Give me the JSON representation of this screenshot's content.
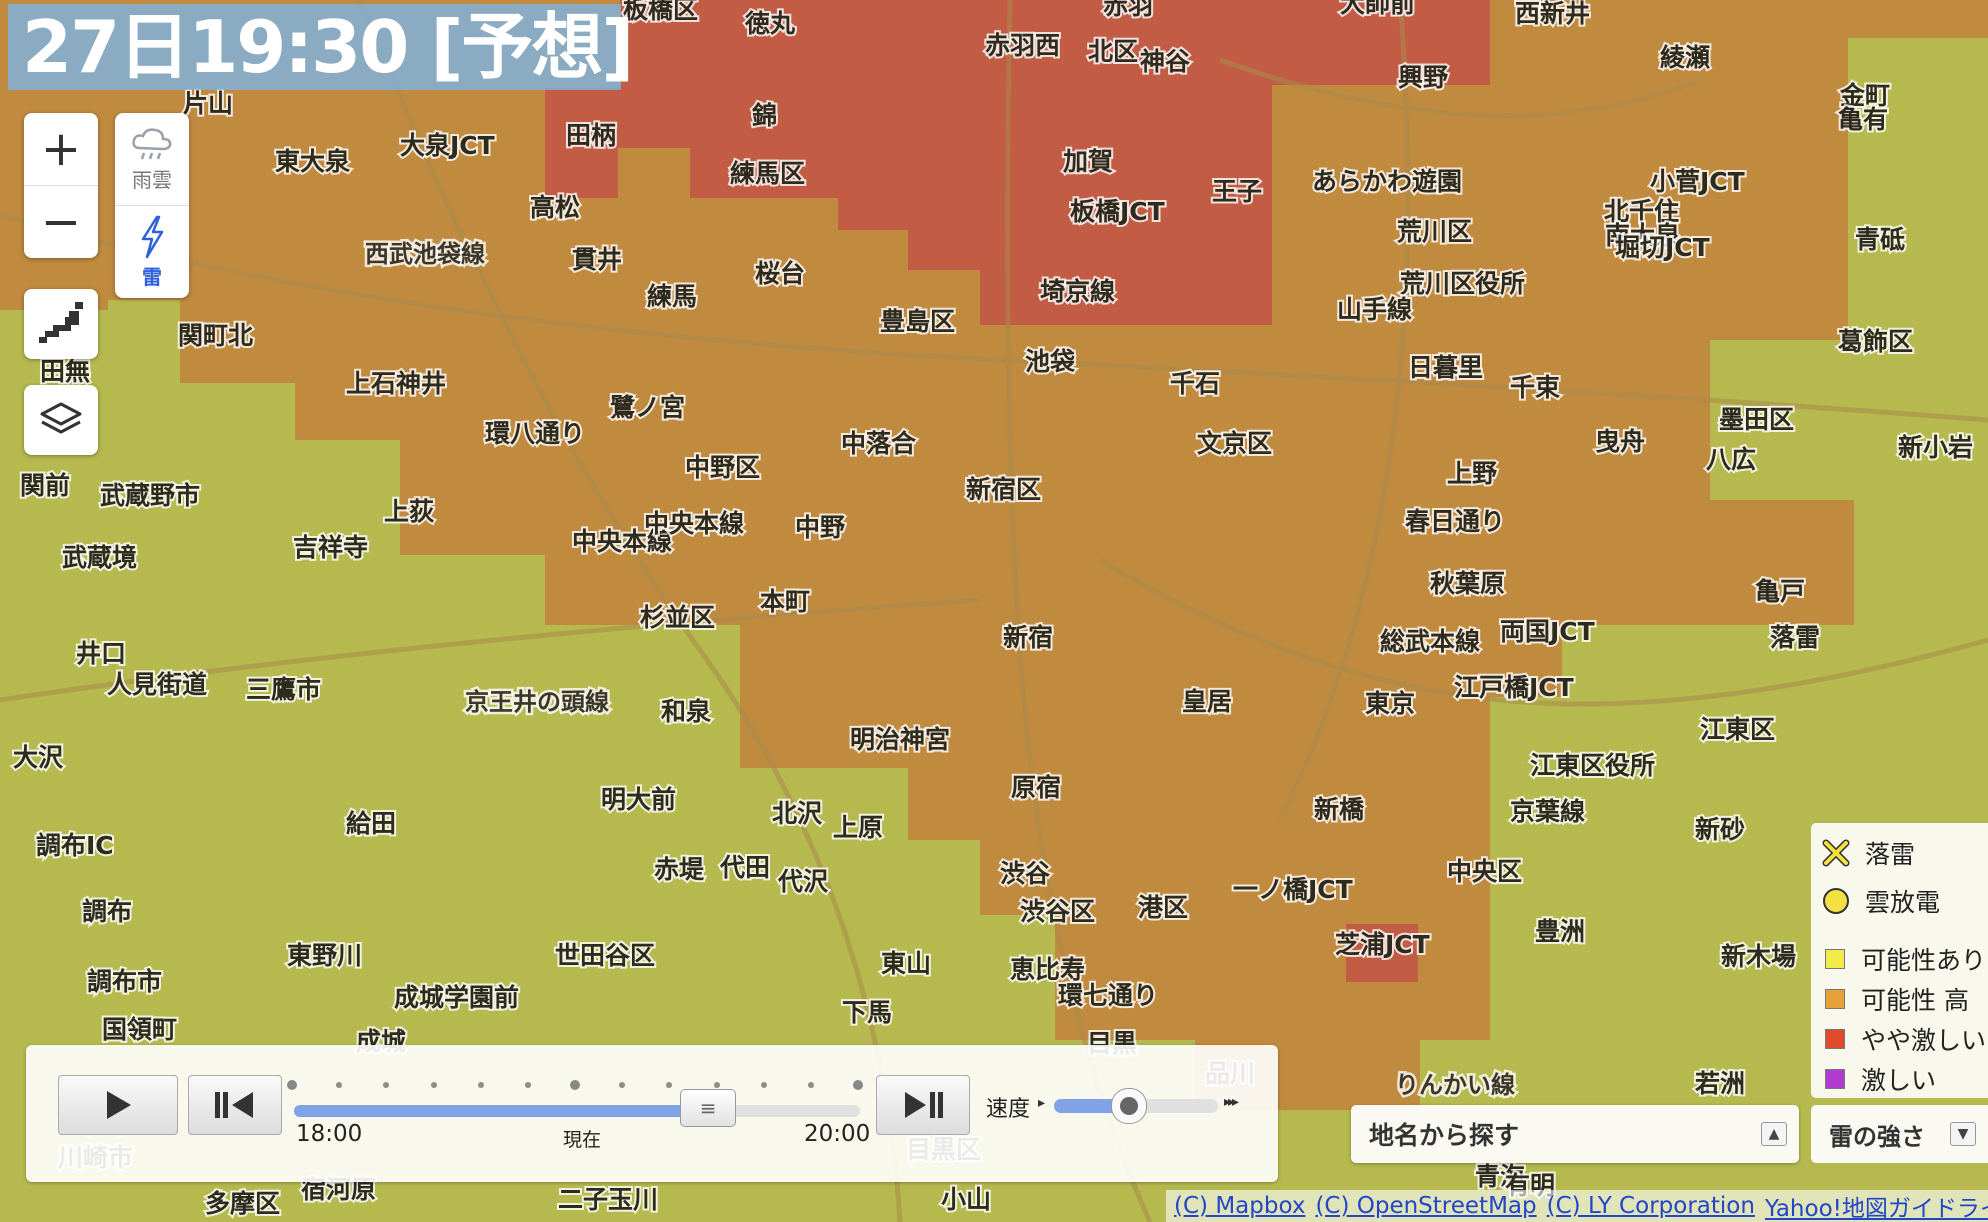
{
  "banner": {
    "time_text": "27日19:30 [予想]"
  },
  "controls": {
    "zoom_in": "+",
    "zoom_out": "−",
    "rain_label": "雨雲",
    "thunder_label": "雷"
  },
  "player": {
    "time_start": "18:00",
    "time_now": "現在",
    "time_end": "20:00",
    "position_fraction": 0.73,
    "speed_label": "速度",
    "speed_fraction": 0.45
  },
  "place_search": {
    "label": "地名から探す"
  },
  "legend": {
    "toggle_label": "雷の強さ",
    "items": [
      {
        "label": "落雷",
        "icon": "cross-icon",
        "color": "#f4e040"
      },
      {
        "label": "雲放電",
        "icon": "circle-icon",
        "color": "#f4e040"
      },
      {
        "label": "可能性あり",
        "color": "#f1ea48"
      },
      {
        "label": "可能性 高",
        "color": "#e6a13a"
      },
      {
        "label": "やや激しい",
        "color": "#e04a2b"
      },
      {
        "label": "激しい",
        "color": "#b13ad1"
      }
    ]
  },
  "attribution": {
    "links": [
      "(C) Mapbox",
      "(C) OpenStreetMap",
      "(C) LY Corporation",
      "Yahoo!地図ガイドライン"
    ]
  },
  "map": {
    "colors": {
      "base": "#b5b94e",
      "medium": "#c08a3f",
      "high": "#c25c45"
    },
    "labels": [
      "板橋区",
      "徳丸",
      "赤羽",
      "大師前",
      "西新井",
      "赤羽西",
      "北区",
      "神谷",
      "興野",
      "綾瀬",
      "片山",
      "田柄",
      "錦",
      "加賀",
      "王子",
      "金町",
      "亀有",
      "東大泉",
      "大泉JCT",
      "練馬区",
      "板橋JCT",
      "あらかわ遊園",
      "小菅JCT",
      "北千住",
      "南大泉",
      "高松",
      "荒川区",
      "堀切JCT",
      "青砥",
      "西武池袋線",
      "貫井",
      "桜台",
      "埼京線",
      "荒川区役所",
      "練馬",
      "豊島区",
      "日暮里",
      "葛飾区",
      "関町北",
      "池袋",
      "千束",
      "田無",
      "上石神井",
      "千石",
      "墨田区",
      "鷺ノ宮",
      "中落合",
      "文京区",
      "曳舟",
      "八広",
      "新小岩",
      "中野区",
      "上野",
      "関前",
      "武蔵野市",
      "新宿区",
      "上荻",
      "春日通り",
      "中央本線",
      "中野",
      "武蔵境",
      "吉祥寺",
      "秋葉原",
      "亀戸",
      "杉並区",
      "本町",
      "両国JCT",
      "総武本線",
      "井口",
      "新宿",
      "江戸橋JCT",
      "三鷹市",
      "京王井の頭線",
      "和泉",
      "皇居",
      "東京",
      "江東区",
      "大沢",
      "明治神宮",
      "江東区役所",
      "明大前",
      "北沢",
      "原宿",
      "新橋",
      "京葉線",
      "調布IC",
      "給田",
      "上原",
      "新砂",
      "赤堤",
      "代田",
      "代沢",
      "渋谷",
      "中央区",
      "落雷",
      "一ノ橋JCT",
      "調布",
      "渋谷区",
      "港区",
      "芝浦JCT",
      "豊洲",
      "新木場",
      "東野川",
      "世田谷区",
      "東山",
      "恵比寿",
      "調布市",
      "成城学園前",
      "下馬",
      "国領町",
      "成城",
      "目黒",
      "品川",
      "りんかい線",
      "若洲",
      "川崎市",
      "目黒区",
      "多摩区",
      "宿河原",
      "二子玉川",
      "小山",
      "青海",
      "有明",
      "人見街道",
      "環八通り",
      "環七通り",
      "山手線",
      "中央本線"
    ]
  }
}
